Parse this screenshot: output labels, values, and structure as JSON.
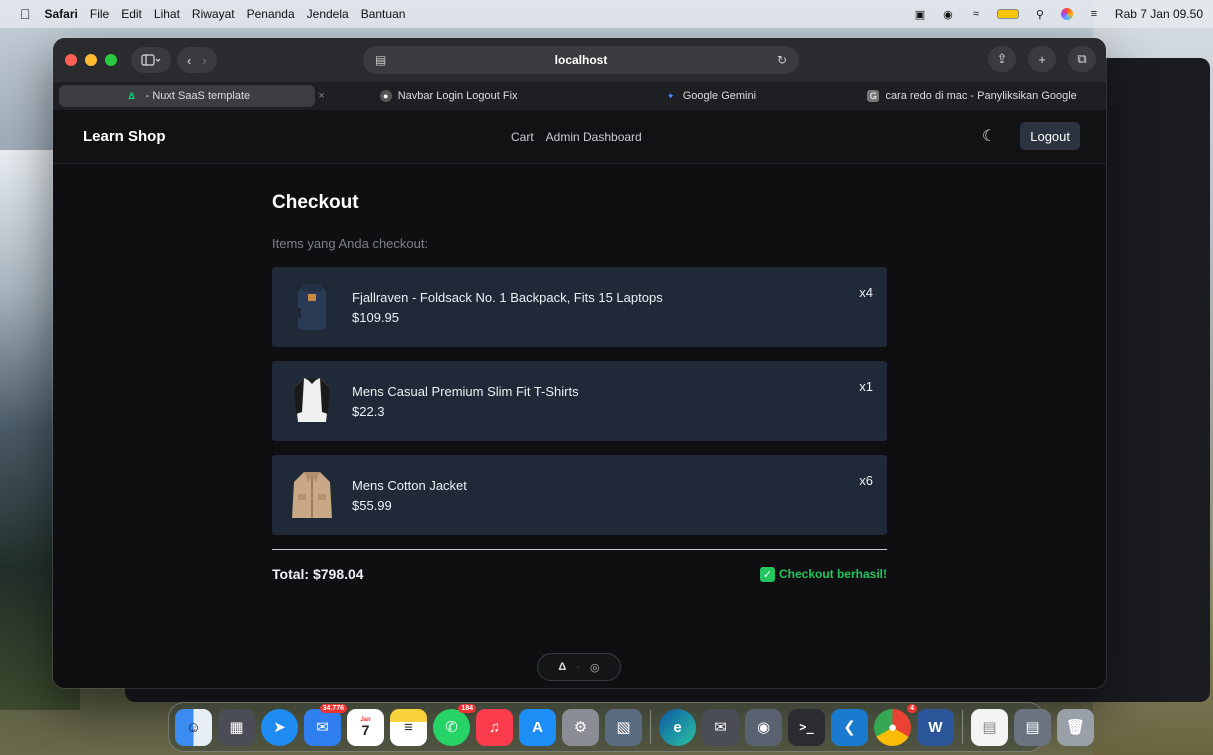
{
  "menubar": {
    "apple": "",
    "items": [
      "Safari",
      "File",
      "Edit",
      "Lihat",
      "Riwayat",
      "Penanda",
      "Jendela",
      "Bantuan"
    ],
    "clock": "Rab 7 Jan  09.50"
  },
  "browser": {
    "address": "localhost",
    "tabs": [
      {
        "title": "- Nuxt SaaS template",
        "icon": "nuxt-icon",
        "active": true
      },
      {
        "title": "Navbar Login Logout Fix",
        "icon": "github-icon",
        "active": false
      },
      {
        "title": "Google Gemini",
        "icon": "gemini-icon",
        "active": false
      },
      {
        "title": "cara redo di mac - Panyliksikan Google",
        "icon": "google-icon",
        "active": false
      }
    ]
  },
  "nav": {
    "brand": "Learn Shop",
    "links": [
      "Cart",
      "Admin Dashboard"
    ],
    "logout": "Logout"
  },
  "checkout": {
    "title": "Checkout",
    "subtitle": "Items yang Anda checkout:",
    "items": [
      {
        "name": "Fjallraven - Foldsack No. 1 Backpack, Fits 15 Laptops",
        "price": "$109.95",
        "qty": "x4",
        "thumb": "backpack-image"
      },
      {
        "name": "Mens Casual Premium Slim Fit T-Shirts",
        "price": "$22.3",
        "qty": "x1",
        "thumb": "tshirt-image"
      },
      {
        "name": "Mens Cotton Jacket",
        "price": "$55.99",
        "qty": "x6",
        "thumb": "jacket-image"
      }
    ],
    "total": "Total: $798.04",
    "success": "Checkout berhasil!"
  },
  "dock": {
    "badges": {
      "mail": "34.776",
      "whatsapp": "184",
      "chrome": "4"
    },
    "calendar": {
      "month": "Jan",
      "day": "7"
    }
  }
}
